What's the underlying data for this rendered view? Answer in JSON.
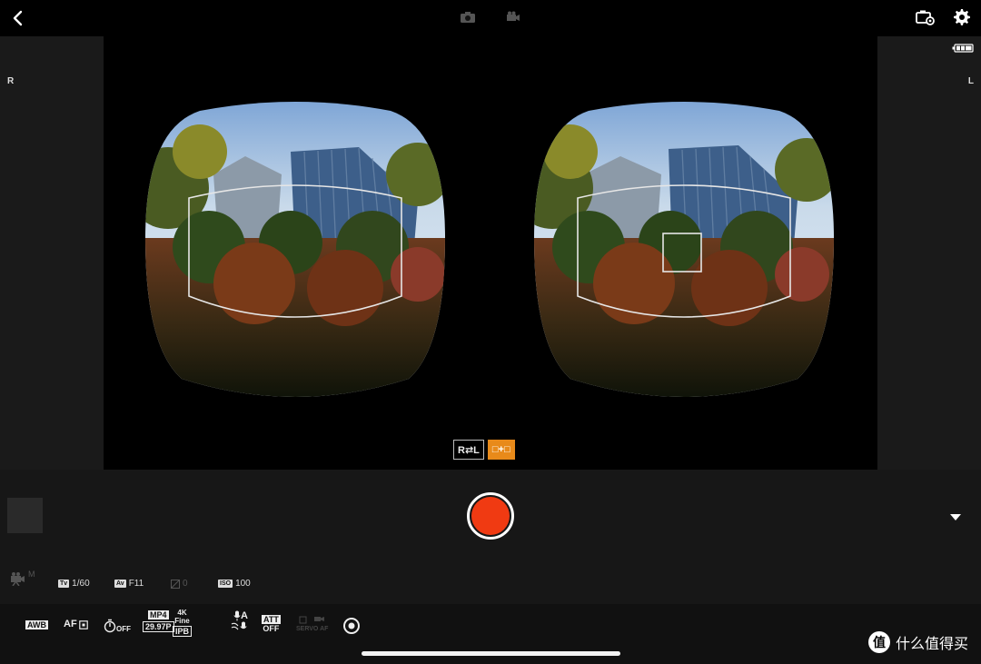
{
  "top_bar": {
    "back_icon": "chevron-left-icon",
    "mode_photo_icon": "camera-icon",
    "mode_movie_icon": "video-camera-icon",
    "camera_settings_icon": "camera-settings-icon",
    "settings_icon": "gear-icon"
  },
  "side_panels": {
    "left_label": "R",
    "right_label": "L",
    "battery_icon": "battery-icon"
  },
  "view_toggle": {
    "swap_label": "R⇄L",
    "dual_label": "□+□",
    "active": "dual"
  },
  "controls": {
    "record_icon": "record-icon",
    "expand_icon": "caret-down-icon"
  },
  "exposure": {
    "movie_mode_badge": "M",
    "tv_badge": "Tv",
    "tv_value": "1/60",
    "av_badge": "Av",
    "av_value": "F11",
    "exp_comp_value": "0",
    "iso_badge": "ISO",
    "iso_value": "100"
  },
  "settings": {
    "wb": "AWB",
    "af_label": "AF",
    "drive_off": "OFF",
    "format_top": "MP4",
    "format_bottom": "29.97P",
    "quality_top": "4K",
    "quality_fine": "Fine",
    "quality_bottom": "IPB",
    "audio_top": "A",
    "att_top": "ATT",
    "att_bottom": "OFF",
    "servo_label": "SERVO AF"
  },
  "watermark": {
    "logo": "值",
    "text": "什么值得买"
  },
  "colors": {
    "record_red": "#f03a12",
    "active_orange": "#e88a1a",
    "panel_gray": "#1a1a1a"
  }
}
